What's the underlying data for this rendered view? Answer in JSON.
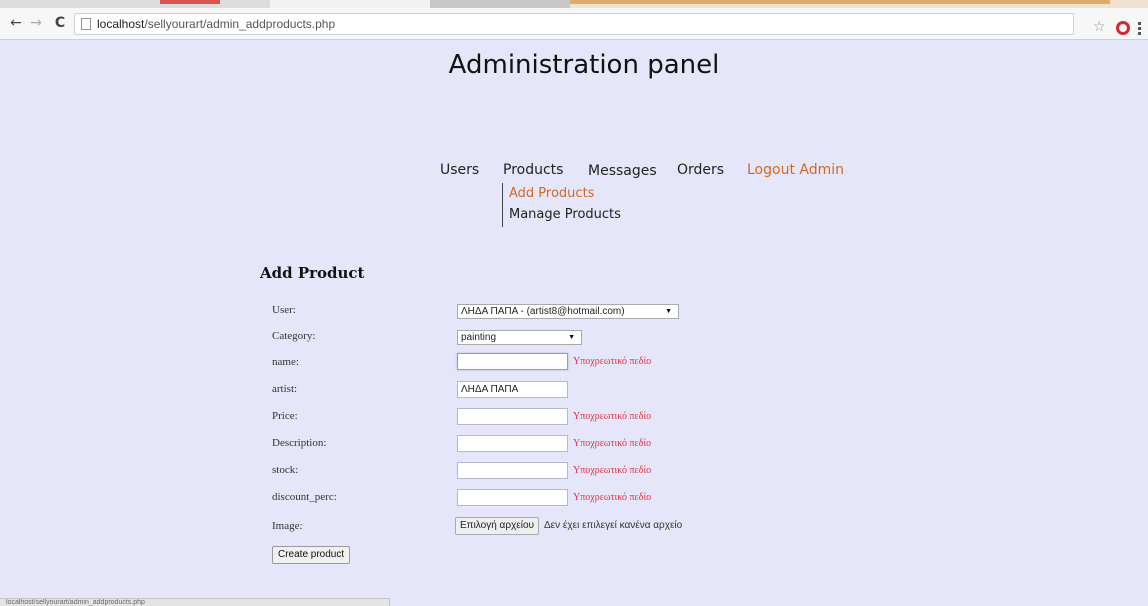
{
  "browser": {
    "url_host": "localhost",
    "url_path": "/sellyourart/admin_addproducts.php",
    "status_text": "localhost/sellyourart/admin_addproducts.php"
  },
  "page": {
    "title": "Administration panel"
  },
  "nav": {
    "items": [
      "Users",
      "Products",
      "Messages",
      "Orders"
    ],
    "logout": "Logout Admin",
    "submenu": [
      "Add Products",
      "Manage Products"
    ]
  },
  "form": {
    "heading": "Add Product",
    "required_text": "Υποχρεωτικό πεδίο",
    "fields": {
      "user": {
        "label": "User:",
        "value": "ΛΗΔΑ ΠΑΠΑ - (artist8@hotmail.com)"
      },
      "category": {
        "label": "Category:",
        "value": "painting"
      },
      "name": {
        "label": "name:",
        "value": ""
      },
      "artist": {
        "label": "artist:",
        "value": "ΛΗΔΑ ΠΑΠΑ"
      },
      "price": {
        "label": "Price:",
        "value": ""
      },
      "description": {
        "label": "Description:",
        "value": ""
      },
      "stock": {
        "label": "stock:",
        "value": ""
      },
      "discount_perc": {
        "label": "discount_perc:",
        "value": ""
      },
      "image": {
        "label": "Image:",
        "button": "Επιλογή αρχείου",
        "status": "Δεν έχει επιλεγεί κανένα αρχείο"
      }
    },
    "submit_label": "Create product"
  },
  "colors": {
    "background": "#e6e6fa",
    "accent": "#d2691e",
    "required": "#e0313f"
  }
}
